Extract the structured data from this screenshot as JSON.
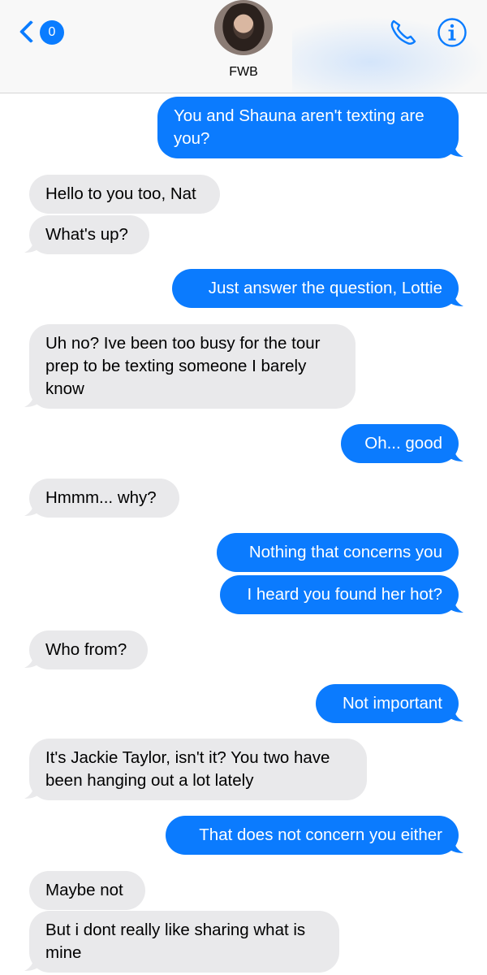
{
  "header": {
    "back_badge": "0",
    "contact_name": "FWB"
  },
  "messages": [
    {
      "from": "me",
      "text": "You and Shauna aren't texting are you?"
    },
    {
      "from": "them",
      "text": "Hello to you too, Nat"
    },
    {
      "from": "them",
      "text": "What's up?"
    },
    {
      "from": "me",
      "text": "Just answer the question, Lottie"
    },
    {
      "from": "them",
      "text": "Uh no? Ive been too busy for the tour prep to be texting someone I barely know"
    },
    {
      "from": "me",
      "text": "Oh... good"
    },
    {
      "from": "them",
      "text": "Hmmm... why?"
    },
    {
      "from": "me",
      "text": "Nothing that concerns you"
    },
    {
      "from": "me",
      "text": "I heard you found her hot?"
    },
    {
      "from": "them",
      "text": "Who from?"
    },
    {
      "from": "me",
      "text": "Not important"
    },
    {
      "from": "them",
      "text": "It's Jackie Taylor, isn't it? You two have been hanging out a lot lately"
    },
    {
      "from": "me",
      "text": "That does not concern you either"
    },
    {
      "from": "them",
      "text": "Maybe not"
    },
    {
      "from": "them",
      "text": "But i dont really like sharing what is mine"
    }
  ],
  "colors": {
    "outgoing": "#0b7bfe",
    "incoming": "#e9e9eb",
    "accent": "#0a7cff"
  }
}
